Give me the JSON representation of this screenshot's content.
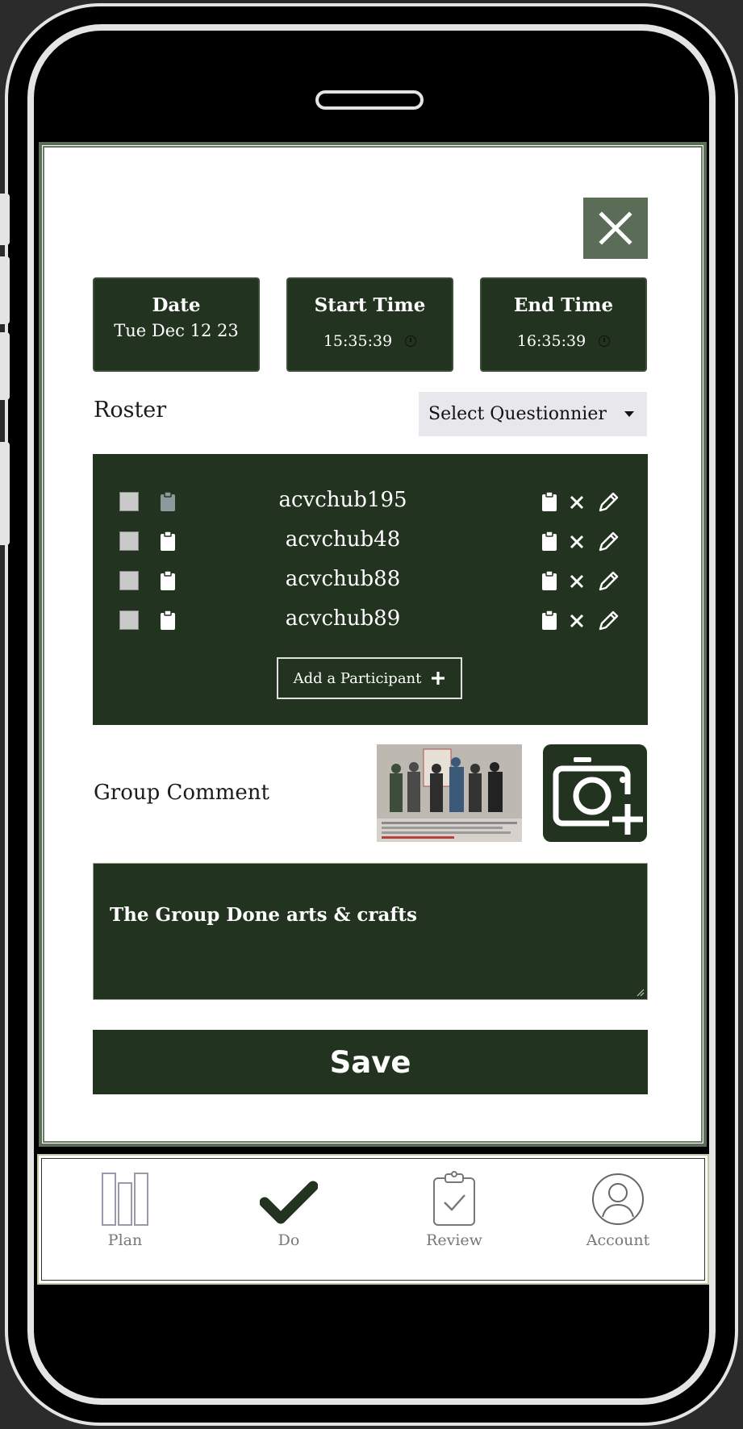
{
  "header": {
    "date_label": "Date",
    "date_value": "Tue Dec 12 23",
    "start_label": "Start Time",
    "start_value": "15:35:39",
    "end_label": "End Time",
    "end_value": "16:35:39"
  },
  "roster": {
    "label": "Roster",
    "select_value": "Select Questionnier",
    "participants": [
      {
        "name": "acvchub195"
      },
      {
        "name": "acvchub48"
      },
      {
        "name": "acvchub88"
      },
      {
        "name": "acvchub89"
      }
    ],
    "add_label": "Add a Participant"
  },
  "comment": {
    "label": "Group Comment",
    "text": "The Group Done arts & crafts"
  },
  "save_label": "Save",
  "nav": {
    "items": [
      {
        "label": "Plan",
        "icon": "plan-icon"
      },
      {
        "label": "Do",
        "icon": "checkmark-icon"
      },
      {
        "label": "Review",
        "icon": "clipboard-check-icon"
      },
      {
        "label": "Account",
        "icon": "user-circle-icon"
      }
    ]
  },
  "colors": {
    "primary": "#22331f",
    "accent": "#5b6d57",
    "select_bg": "#e7e7ec"
  }
}
